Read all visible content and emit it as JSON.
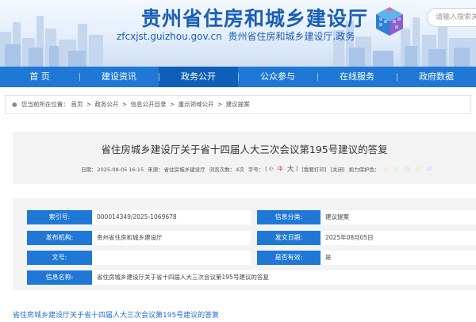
{
  "header": {
    "site_title": "贵州省住房和城乡建设厅",
    "domain": "zfcxjst.guizhou.gov.cn",
    "domain_suffix": "贵州省住房和城乡建设厅.政务",
    "search_placeholder": "请输入搜索关键字"
  },
  "nav": {
    "items": [
      "首 页",
      "建设资讯",
      "政务公开",
      "公众参与",
      "在线服务",
      "政府数据"
    ],
    "active_index": 2
  },
  "breadcrumb": {
    "prefix": "您当前所在位置：",
    "items": [
      "首页",
      "政务公开",
      "信息公开目录",
      "重点领域公开",
      "建议提案"
    ],
    "separator": ">"
  },
  "article": {
    "title": "省住房城乡建设厅关于省十四届人大三次会议第195号建议的答复",
    "date_label": "日期：",
    "date": "2025-08-05 16:15",
    "source_label": "来源：",
    "source": "省住房城乡建设厅",
    "views_label": "浏览次数：",
    "views": "4次",
    "font_label": "字号：",
    "font_small": "小",
    "font_mid": "中",
    "font_large": "大",
    "print_label": "[我要打印]",
    "close_label": "[关闭]",
    "eye_label": "视力保护色：",
    "eye_colors": [
      "#f9e9e9",
      "#e8f4e3",
      "#dfeff9",
      "#f3f0da",
      "#ede3f5",
      "#f3f3f3"
    ]
  },
  "info_table": {
    "index_label": "索引号:",
    "index_value": "000014349/2025-1069678",
    "category_label": "信息分类:",
    "category_value": "建议提案",
    "publisher_label": "发布机构:",
    "publisher_value": "贵州省住房和城乡建设厅",
    "date_label": "发文日期:",
    "date_value": "2025年08月05日",
    "doc_no_label": "文号:",
    "doc_no_value": "",
    "valid_label": "是否有效:",
    "valid_value": "是",
    "name_label": "信息名称:",
    "name_value": "省住房城乡建设厅关于省十四届人大三次会议第195号建议的答复"
  },
  "bottom_link": "省住房城乡建设厅关于省十四届人大三次会议第195号建议的答复",
  "colors": {
    "nav_blue": "#1f78d6",
    "nav_active": "#0f5fb8",
    "title_blue": "#1b5fb5",
    "panel_gray": "#f3f3f3"
  }
}
